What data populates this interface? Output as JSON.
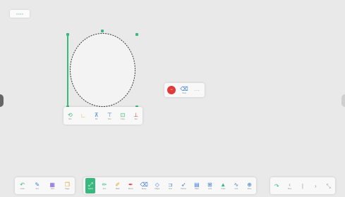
{
  "menu": {
    "label": "≡ ≡ ≡ ≡"
  },
  "colors": {
    "accent": "#3ab97f",
    "delete": "#e03a3a",
    "panel": "#f8f8f8",
    "canvas": "#e9e9e9"
  },
  "shape_tools": [
    {
      "icon": "rotate-icon",
      "glyph": "⟲",
      "label": "Rot",
      "color": "#3ab97f"
    },
    {
      "icon": "line-icon",
      "glyph": "∟",
      "label": "",
      "color": "#e0a020"
    },
    {
      "icon": "fill-icon",
      "glyph": "⊼",
      "label": "Fill",
      "color": "#3a7bd5"
    },
    {
      "icon": "pen-icon",
      "glyph": "⊤",
      "label": "Pen",
      "color": "#3a7bd5"
    },
    {
      "icon": "copy-icon",
      "glyph": "⊡",
      "label": "Copy",
      "color": "#3ab97f"
    },
    {
      "icon": "delete-icon",
      "glyph": "⊥",
      "label": "Del",
      "color": "#e03a3a"
    }
  ],
  "context_menu": [
    {
      "icon": "delete-circle-icon",
      "glyph": "−"
    },
    {
      "icon": "eraser-icon",
      "glyph": "⌫",
      "label": "Clear"
    },
    {
      "icon": "more-icon",
      "glyph": "⋯"
    }
  ],
  "bottom_left": [
    {
      "icon": "undo-icon",
      "glyph": "↶",
      "label": "Undo",
      "color": "#3ab97f"
    },
    {
      "icon": "pen-style-icon",
      "glyph": "✎",
      "label": "Pen",
      "color": "#3a7bd5"
    },
    {
      "icon": "grid-icon",
      "glyph": "▦",
      "label": "Grid",
      "color": "#7a5bd5"
    },
    {
      "icon": "page-icon",
      "glyph": "❐",
      "label": "Page",
      "color": "#e0a020"
    }
  ],
  "bottom_main": [
    {
      "icon": "select-icon",
      "glyph": "⤢",
      "label": "Select",
      "active": true
    },
    {
      "icon": "pencil-icon",
      "glyph": "✏",
      "label": "Pen",
      "color": "#3ab97f"
    },
    {
      "icon": "marker-icon",
      "glyph": "✐",
      "label": "Mark",
      "color": "#e0a020"
    },
    {
      "icon": "brush-icon",
      "glyph": "✒",
      "label": "Brush",
      "color": "#e03a3a"
    },
    {
      "icon": "eraser-tool-icon",
      "glyph": "⌫",
      "label": "Erase",
      "color": "#3a7bd5"
    },
    {
      "icon": "shape-icon",
      "glyph": "◇",
      "label": "Shape",
      "color": "#3a7bd5"
    },
    {
      "icon": "text-icon",
      "glyph": "⊐",
      "label": "Text",
      "color": "#3a7bd5"
    },
    {
      "icon": "pointer-icon",
      "glyph": "➶",
      "label": "Pointer",
      "color": "#3a7bd5"
    },
    {
      "icon": "table-icon",
      "glyph": "▤",
      "label": "Table",
      "color": "#3a7bd5"
    },
    {
      "icon": "lock-icon",
      "glyph": "⊞",
      "label": "Lock",
      "color": "#3a7bd5"
    },
    {
      "icon": "chart-icon",
      "glyph": "▲",
      "label": "Chart",
      "color": "#3ab97f"
    },
    {
      "icon": "link-icon",
      "glyph": "∿",
      "label": "Link",
      "color": "#3a7bd5"
    },
    {
      "icon": "more-tools-icon",
      "glyph": "⊕",
      "label": "More",
      "color": "#3a7bd5"
    }
  ],
  "bottom_right": [
    {
      "icon": "redo-icon",
      "glyph": "↷",
      "label": "",
      "color": "#3ab97f"
    },
    {
      "icon": "back-icon",
      "glyph": "‹",
      "label": "Prev",
      "color": "#999"
    },
    {
      "icon": "page-number-icon",
      "glyph": "|",
      "label": "",
      "color": "#999"
    },
    {
      "icon": "forward-icon",
      "glyph": "›",
      "label": "",
      "color": "#999"
    },
    {
      "icon": "expand-icon",
      "glyph": "⤡",
      "label": "",
      "color": "#999"
    }
  ]
}
